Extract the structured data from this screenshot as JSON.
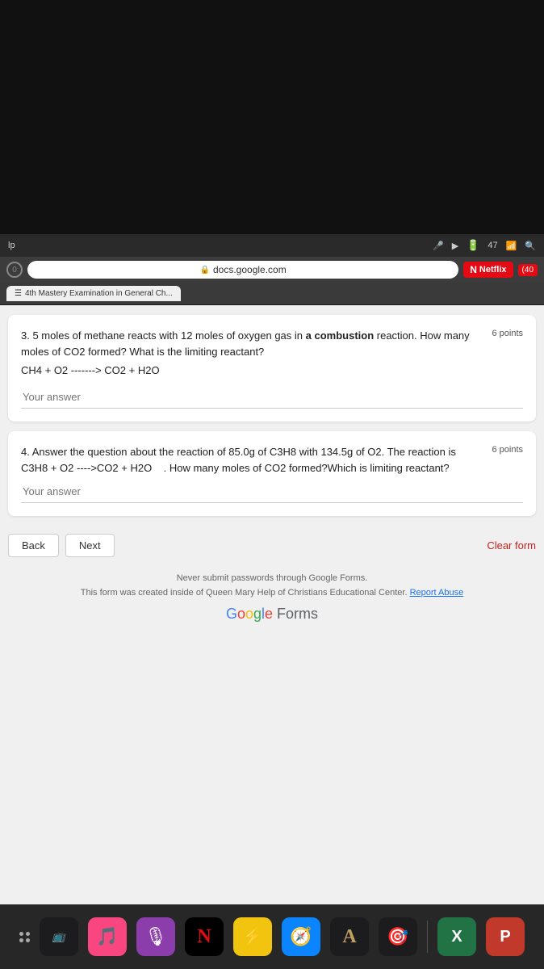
{
  "system": {
    "address": "docs.google.com",
    "lock_icon": "🔒",
    "battery": "47",
    "wifi": "wifi",
    "search": "search"
  },
  "browser": {
    "tab_label": "4th Mastery Examination in General Ch...",
    "netflix_label": "Netflix",
    "youtube_badge": "(40"
  },
  "questions": [
    {
      "id": "q3",
      "text": "3. 5 moles of methane reacts with 12 moles of oxygen gas in a combustion reaction. How many moles of CO2 formed? What is the limiting reactant?",
      "bold_part": "a combustion",
      "equation": "CH4 + O2 -------> CO2 + H2O",
      "points": "6 points",
      "answer_placeholder": "Your answer"
    },
    {
      "id": "q4",
      "text": "4. Answer the question about the reaction of 85.0g of C3H8 with 134.5g of O2. The reaction is C3H8 + O2 ---->CO2 + H2O   . How many moles of CO2 formed?Which is limiting reactant?",
      "points": "6 points",
      "answer_placeholder": "Your answer"
    }
  ],
  "buttons": {
    "back": "Back",
    "next": "Next",
    "clear_form": "Clear form"
  },
  "footer": {
    "disclaimer": "Never submit passwords through Google Forms.",
    "created_by": "This form was created inside of Queen Mary Help of Christians Educational Center.",
    "report_link": "Report Abuse",
    "logo": "Google Forms"
  },
  "dock": {
    "items": [
      {
        "name": "grid",
        "emoji": "⠿"
      },
      {
        "name": "apple-tv",
        "label": "tv"
      },
      {
        "name": "music",
        "emoji": "🎵"
      },
      {
        "name": "podcasts",
        "emoji": "🎙"
      },
      {
        "name": "netflix",
        "emoji": "N"
      },
      {
        "name": "bolt",
        "emoji": "⚡"
      },
      {
        "name": "compass",
        "emoji": "🧭"
      },
      {
        "name": "font-A",
        "emoji": "A"
      },
      {
        "name": "target",
        "emoji": "🎯"
      },
      {
        "name": "excel",
        "label": "X"
      },
      {
        "name": "powerpoint",
        "label": "P"
      }
    ]
  }
}
